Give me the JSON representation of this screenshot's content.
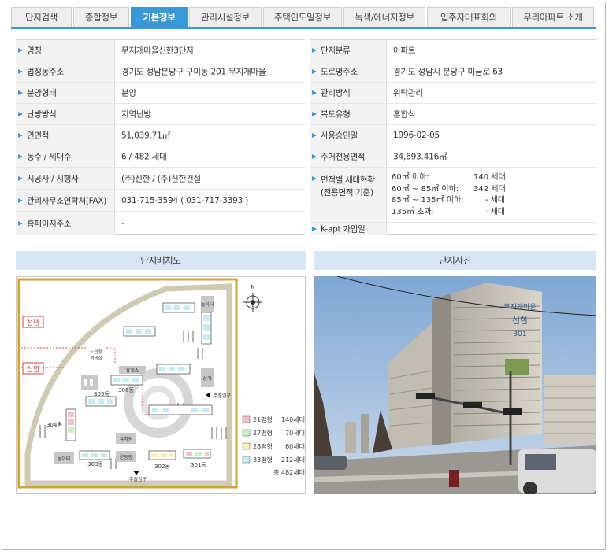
{
  "tabs": [
    {
      "label": "단지검색",
      "active": false
    },
    {
      "label": "종합정보",
      "active": false
    },
    {
      "label": "기본정보",
      "active": true
    },
    {
      "label": "관리시설정보",
      "active": false
    },
    {
      "label": "주택인도일정보",
      "active": false
    },
    {
      "label": "녹색/에너지정보",
      "active": false
    },
    {
      "label": "입주자대표회의",
      "active": false
    },
    {
      "label": "우리아파트 소개",
      "active": false
    }
  ],
  "left_info": [
    {
      "label": "명칭",
      "value": "무지개마을신한3단지"
    },
    {
      "label": "법정동주소",
      "value": "경기도 성남분당구 구미동 201 무지개마을"
    },
    {
      "label": "분양형태",
      "value": "분양"
    },
    {
      "label": "난방방식",
      "value": "지역난방"
    },
    {
      "label": "연면적",
      "value": "51,039.71㎡"
    },
    {
      "label": "동수 / 세대수",
      "value": "6 / 482 세대"
    },
    {
      "label": "시공사 / 시행사",
      "value": "(주)신한 / (주)신한건설"
    },
    {
      "label": "관리사무소연락처(FAX)",
      "value": "031-715-3594 ( 031-717-3393 )"
    },
    {
      "label": "홈페이지주소",
      "value": "-"
    }
  ],
  "right_info": [
    {
      "label": "단지분류",
      "value": "아파트"
    },
    {
      "label": "도로명주소",
      "value": "경기도 성남시 분당구 미금로 63"
    },
    {
      "label": "관리방식",
      "value": "위탁관리"
    },
    {
      "label": "복도유형",
      "value": "혼합식"
    },
    {
      "label": "사용승인일",
      "value": "1996-02-05"
    },
    {
      "label": "주거전용면적",
      "value": "34,693.416㎡"
    }
  ],
  "area_breakdown": {
    "label_line1": "면적별 세대현황",
    "label_line2": "(전용면적 기준)",
    "rows": [
      {
        "range": "60㎡ 이하:",
        "count": "140 세대"
      },
      {
        "range": "60㎡ ~ 85㎡ 이하:",
        "count": "342 세대"
      },
      {
        "range": "85㎡ ~ 135㎡ 이하:",
        "count": "- 세대"
      },
      {
        "range": "135㎡ 초과:",
        "count": "- 세대"
      }
    ]
  },
  "kapt": {
    "label": "K-apt 가입일",
    "value": ""
  },
  "sections": {
    "layout_title": "단지배치도",
    "photo_title": "단지사진"
  },
  "site_map": {
    "north": "N",
    "left_labels": [
      "선냉",
      "신한"
    ],
    "buildings": [
      "306동",
      "305동",
      "304동",
      "303동",
      "302동",
      "301동"
    ],
    "facilities": [
      "노인정",
      "경비실",
      "휴게소",
      "놀이터",
      "놀이터",
      "유치원",
      "운동장",
      "상가"
    ],
    "entrances": [
      "주출입구",
      "주출입구"
    ],
    "legend": [
      {
        "label": "21평형",
        "count": "140세대",
        "color": "#f4c2c8"
      },
      {
        "label": "27평형",
        "count": "70세대",
        "color": "#c8f0c0"
      },
      {
        "label": "28평형",
        "count": "60세대",
        "color": "#fbf0b0"
      },
      {
        "label": "33평형",
        "count": "212세대",
        "color": "#c0eef2"
      }
    ],
    "total": "총 482세대"
  },
  "photo": {
    "building_sign_1": "무지개마을",
    "building_sign_2": "신한",
    "building_sign_3": "301"
  }
}
